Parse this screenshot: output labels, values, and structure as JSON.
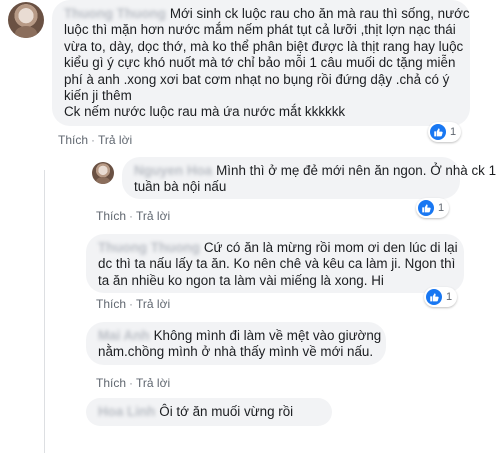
{
  "comments": [
    {
      "author": "Thuong Thuong",
      "lines": [
        "Mới sinh ck luộc rau cho ăn mà rau thì sống, nước",
        "luộc thì mặn hơn nước mắm nếm phát tụt cả lưỡi ,thịt lợn nạc thái",
        "vừa to, dày, dọc thớ, mà ko thể phân biệt được là thịt rang hay luộc",
        "kiểu gì ý cực khó nuốt mà tớ chỉ bảo mỗi 1 câu muối dc tặng miễn",
        "phí à anh .xong xơi bat cơm nhạt no bụng rồi đứng dậy .chả có ý",
        "kiến ji thêm",
        "Ck nếm nước luộc rau mà ứa nước mắt kkkkkk"
      ],
      "like_label": "Thích",
      "reply_label": "Trả lời",
      "reaction_count": "1"
    },
    {
      "author": "Nguyen Hoa",
      "lines": [
        "Mình thì ở mẹ đẻ mới nên ăn ngon. Ở nhà ck 1",
        "tuần bà nội nấu"
      ],
      "like_label": "Thích",
      "reply_label": "Trả lời",
      "reaction_count": "1"
    },
    {
      "author": "Thuong Thuong",
      "lines": [
        "Cứ có ăn là mừng rồi mom ơi den lúc di lại",
        "dc thì ta nấu lấy ta ăn. Ko nên chê và kêu ca làm ji. Ngon thì",
        "ta ăn nhiều ko ngon ta làm vài miếng là xong. Hi"
      ],
      "like_label": "Thích",
      "reply_label": "Trả lời",
      "reaction_count": "1"
    },
    {
      "author": "Mai Anh",
      "lines": [
        "Không mình đi làm về mệt vào giường",
        "nằm.chồng mình ở nhà thấy mình về mới nấu."
      ],
      "like_label": "Thích",
      "reply_label": "Trả lời"
    },
    {
      "author": "Hoa Linh",
      "lines": [
        "Ôi tớ ăn muối vừng rồi"
      ]
    }
  ],
  "colors": {
    "bubble_bg": "#f2f3f5",
    "action_text": "#606770",
    "like_blue": "#1877f2"
  }
}
